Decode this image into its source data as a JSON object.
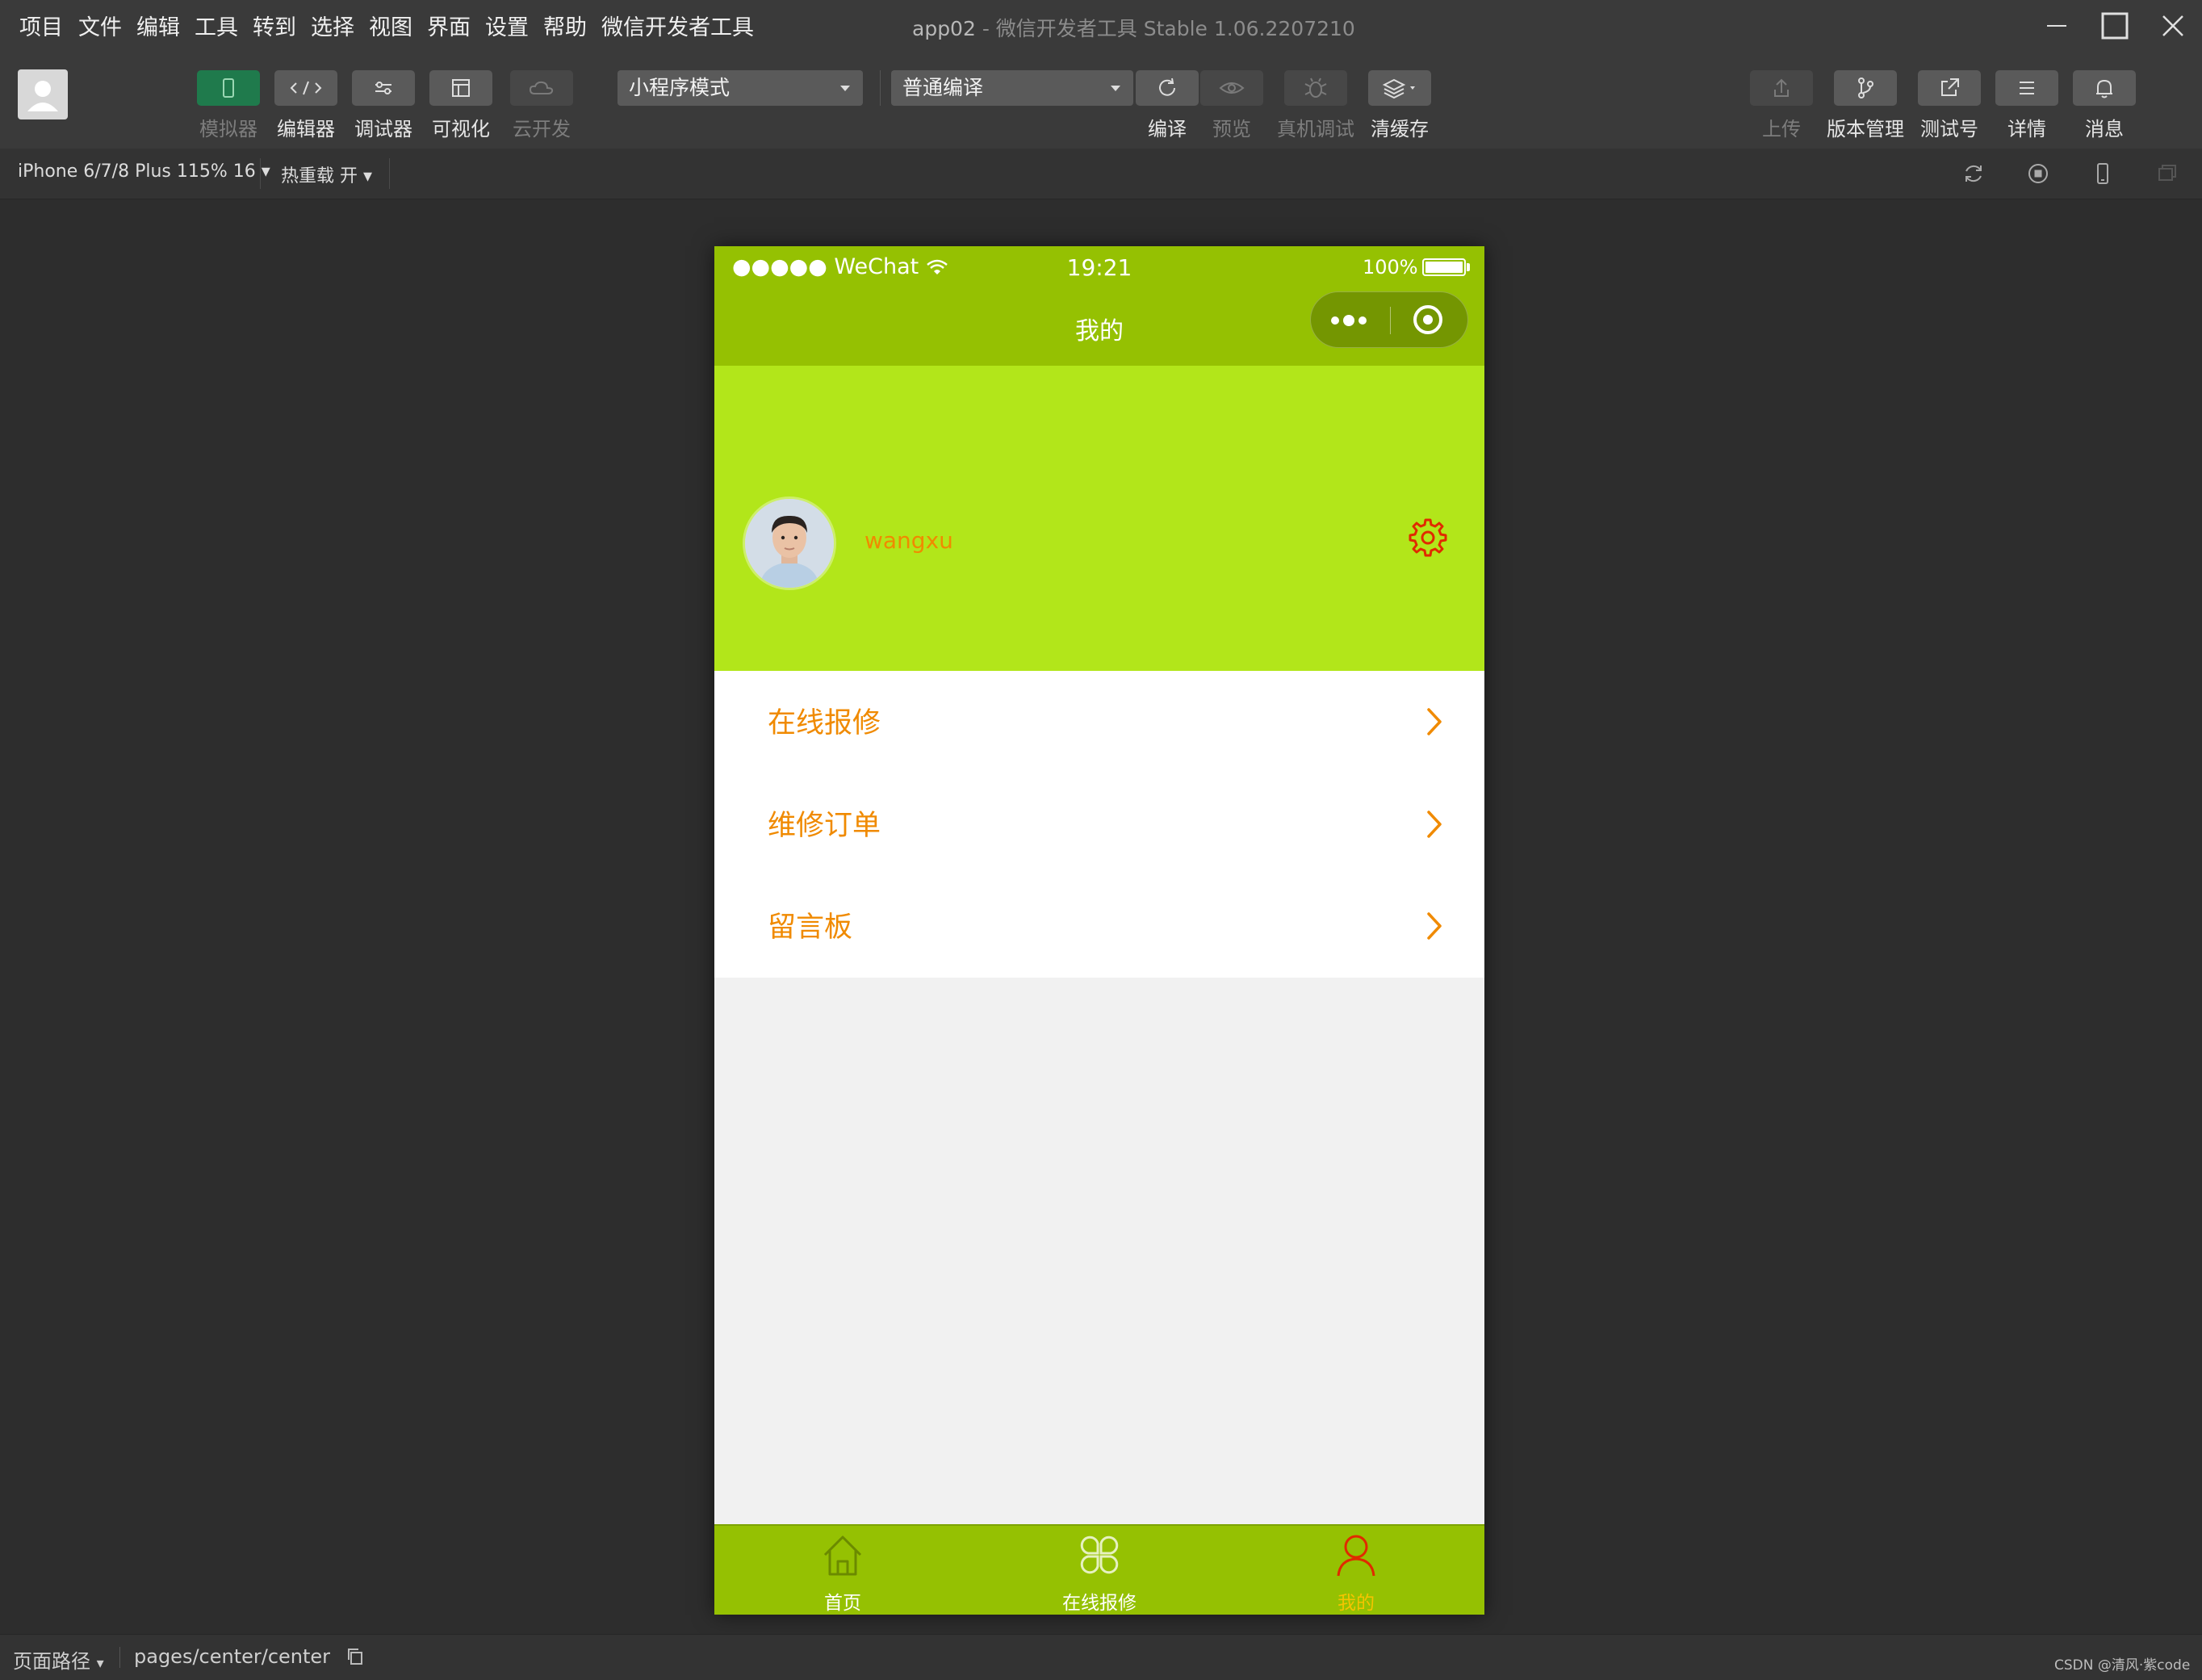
{
  "menubar": {
    "items": [
      "项目",
      "文件",
      "编辑",
      "工具",
      "转到",
      "选择",
      "视图",
      "界面",
      "设置",
      "帮助",
      "微信开发者工具"
    ],
    "title_app": "app02",
    "title_rest": " - 微信开发者工具 Stable 1.06.2207210"
  },
  "toolbar": {
    "simulator": "模拟器",
    "editor": "编辑器",
    "debugger": "调试器",
    "visual": "可视化",
    "cloud": "云开发",
    "mode_select": "小程序模式",
    "compile_select": "普通编译",
    "compile": "编译",
    "preview": "预览",
    "remote_debug": "真机调试",
    "clear_cache": "清缓存",
    "upload": "上传",
    "version": "版本管理",
    "test_account": "测试号",
    "details": "详情",
    "messages": "消息"
  },
  "subbar": {
    "device": "iPhone 6/7/8 Plus 115% 16",
    "hotreload": "热重载 开"
  },
  "phone": {
    "carrier": "●●●●● WeChat",
    "time": "19:21",
    "battery": "100%",
    "nav_title": "我的",
    "username": "wangxu",
    "list": [
      {
        "label": "在线报修"
      },
      {
        "label": "维修订单"
      },
      {
        "label": "留言板"
      }
    ],
    "tabs": [
      {
        "label": "首页",
        "icon": "home-icon",
        "color": "#ffffff"
      },
      {
        "label": "在线报修",
        "icon": "grid-icon",
        "color": "#ffffff"
      },
      {
        "label": "我的",
        "icon": "user-icon",
        "color": "#f5c400"
      }
    ],
    "colors": {
      "nav": "#95c102",
      "header": "#b2e61a",
      "accent": "#f08a00",
      "icon_active": "#e02a00"
    }
  },
  "bottombar": {
    "path_label": "页面路径",
    "path_value": "pages/center/center",
    "watermark": "CSDN @清风·紫code"
  }
}
